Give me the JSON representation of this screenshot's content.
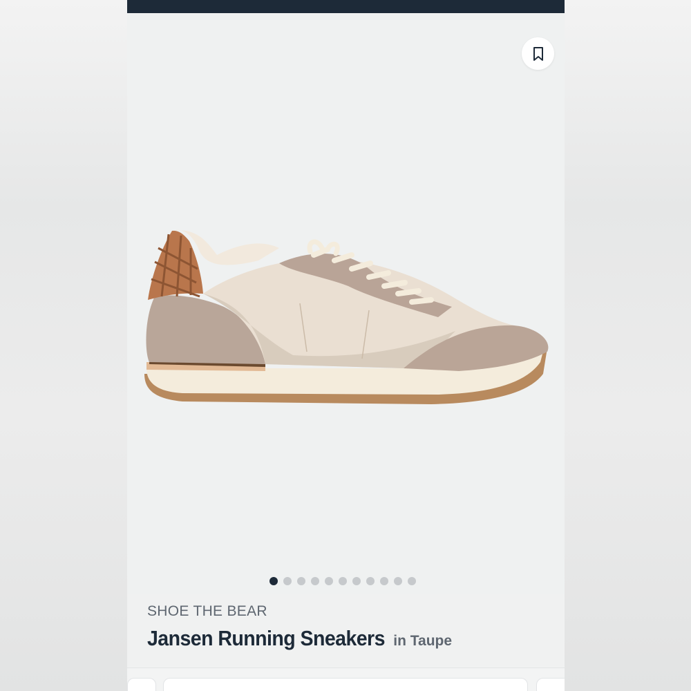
{
  "product": {
    "brand": "SHOE THE BEAR",
    "name": "Jansen Running Sneakers",
    "color_label": "in Taupe"
  },
  "gallery": {
    "image_count": 11,
    "active_index": 0
  },
  "icons": {
    "save": "bookmark-icon"
  },
  "colors": {
    "navy": "#1d2a38",
    "muted_text": "#5e6670",
    "dot_inactive": "#c6c9cc",
    "background": "#eff1f1"
  }
}
